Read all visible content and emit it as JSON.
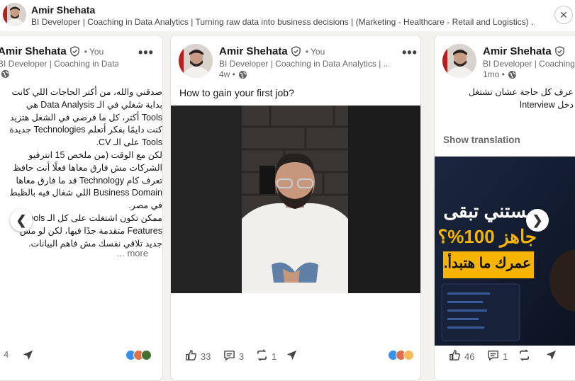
{
  "profile": {
    "name": "Amir Shehata",
    "headline": "BI Developer | Coaching in Data Analytics | Turning raw data into business decisions | (Marketing - Healthcare - Retail and Logistics) ...",
    "close_icon": "close-icon"
  },
  "posts": [
    {
      "author": "Amir Shehata",
      "you": "• You",
      "headline": "BI Developer | Coaching in Data Analytics | ...",
      "time": "",
      "lines": [
        "صدقني والله، من أكتر الحاجات اللي كانت",
        "بداية شغلي في الـ Data Analysis هي",
        "Tools أكتر، كل ما فرصي في الشغل هتزيد",
        "كنت دايمًا بفكر أتعلم Technologies جديدة",
        "Tools على الـ CV.",
        "لكن مع الوقت (من ملخص 15 انترفيو",
        "الشركات مش فارق معاها فعلًا أنت حافظ",
        "تعرف كام Technology قد ما فارق معاها",
        "Business Domain اللي شغال فيه بالظبط",
        "في مصر.",
        "ممكن تكون اشتغلت على كل الـ Tools",
        "Features متقدمة جدًا فيها، لكن لو مش",
        "جديد تلاقي نفسك مش فاهم البيانات."
      ],
      "see_more": "... more",
      "reactions": "",
      "comments": "4",
      "reposts": "",
      "send": "send"
    },
    {
      "author": "Amir Shehata",
      "you": "• You",
      "headline": "BI Developer | Coaching in Data Analytics | ...",
      "time": "4w •",
      "text": "How to gain your first job?",
      "reactions": "33",
      "comments": "3",
      "reposts": "1"
    },
    {
      "author": "Amir Shehata",
      "headline": "BI Developer | Coaching in Data Analytics | ...",
      "time": "1mo •",
      "lines": [
        "عرف كل حاجة عشان تشتغل",
        "دخل Interview"
      ],
      "show_translation": "Show translation",
      "promo": {
        "line1": "مستني تبقى",
        "line2": "جاهز 100%؟",
        "line3": "عمرك ما هتبدأ."
      },
      "reactions": "46",
      "comments": "1"
    }
  ],
  "colors": {
    "accent": "#0a66c2",
    "background": "#f4f2ee",
    "card": "#ffffff",
    "promo_yellow": "#f5b400"
  },
  "nav": {
    "prev_icon": "chevron-left-icon",
    "next_icon": "chevron-right-icon",
    "prev_glyph": "❮",
    "next_glyph": "❯"
  }
}
